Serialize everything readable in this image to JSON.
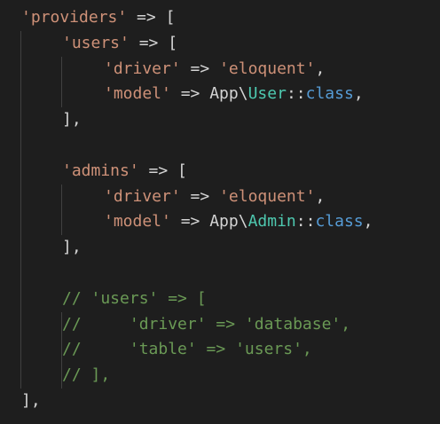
{
  "colors": {
    "background": "#1e1e1e",
    "string": "#ce9178",
    "operator": "#d4d4d4",
    "class_name": "#4ec9b0",
    "keyword": "#569cd6",
    "comment": "#6a9955",
    "indent_guide": "#404040"
  },
  "lines": [
    {
      "indent": 1,
      "tokens": [
        {
          "t": "str",
          "v": "'providers'"
        },
        {
          "t": "op",
          "v": " => ["
        }
      ]
    },
    {
      "indent": 2,
      "tokens": [
        {
          "t": "str",
          "v": "'users'"
        },
        {
          "t": "op",
          "v": " => ["
        }
      ]
    },
    {
      "indent": 3,
      "tokens": [
        {
          "t": "str",
          "v": "'driver'"
        },
        {
          "t": "op",
          "v": " => "
        },
        {
          "t": "str",
          "v": "'eloquent'"
        },
        {
          "t": "punc",
          "v": ","
        }
      ]
    },
    {
      "indent": 3,
      "tokens": [
        {
          "t": "str",
          "v": "'model'"
        },
        {
          "t": "op",
          "v": " => "
        },
        {
          "t": "ns",
          "v": "App\\"
        },
        {
          "t": "cls",
          "v": "User"
        },
        {
          "t": "op",
          "v": "::"
        },
        {
          "t": "kw",
          "v": "class"
        },
        {
          "t": "punc",
          "v": ","
        }
      ]
    },
    {
      "indent": 2,
      "tokens": [
        {
          "t": "punc",
          "v": "],"
        }
      ]
    },
    {
      "indent": 0,
      "tokens": []
    },
    {
      "indent": 2,
      "tokens": [
        {
          "t": "str",
          "v": "'admins'"
        },
        {
          "t": "op",
          "v": " => ["
        }
      ]
    },
    {
      "indent": 3,
      "tokens": [
        {
          "t": "str",
          "v": "'driver'"
        },
        {
          "t": "op",
          "v": " => "
        },
        {
          "t": "str",
          "v": "'eloquent'"
        },
        {
          "t": "punc",
          "v": ","
        }
      ]
    },
    {
      "indent": 3,
      "tokens": [
        {
          "t": "str",
          "v": "'model'"
        },
        {
          "t": "op",
          "v": " => "
        },
        {
          "t": "ns",
          "v": "App\\"
        },
        {
          "t": "cls",
          "v": "Admin"
        },
        {
          "t": "op",
          "v": "::"
        },
        {
          "t": "kw",
          "v": "class"
        },
        {
          "t": "punc",
          "v": ","
        }
      ]
    },
    {
      "indent": 2,
      "tokens": [
        {
          "t": "punc",
          "v": "],"
        }
      ]
    },
    {
      "indent": 0,
      "tokens": []
    },
    {
      "indent": 2,
      "tokens": [
        {
          "t": "cmt",
          "v": "// 'users' => ["
        }
      ]
    },
    {
      "indent": 2,
      "tokens": [
        {
          "t": "cmt",
          "v": "//     'driver' => 'database',"
        }
      ]
    },
    {
      "indent": 2,
      "tokens": [
        {
          "t": "cmt",
          "v": "//     'table' => 'users',"
        }
      ]
    },
    {
      "indent": 2,
      "tokens": [
        {
          "t": "cmt",
          "v": "// ],"
        }
      ]
    },
    {
      "indent": 1,
      "tokens": [
        {
          "t": "punc",
          "v": "],"
        }
      ]
    }
  ]
}
